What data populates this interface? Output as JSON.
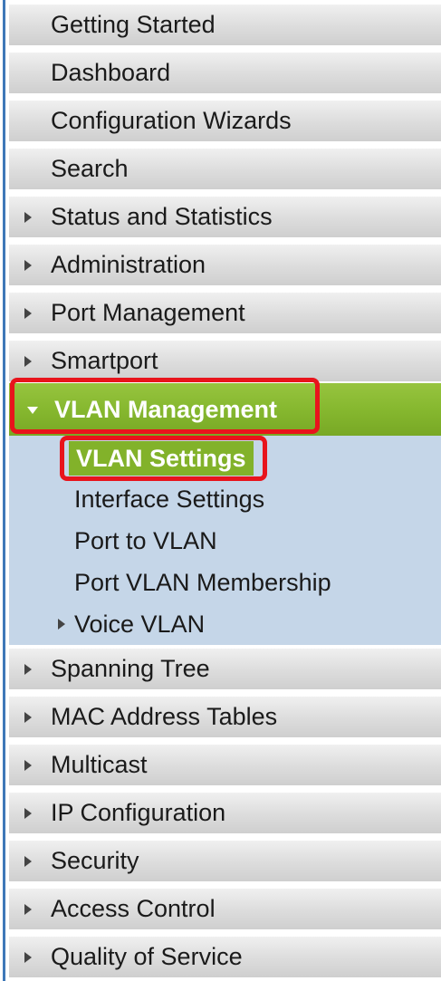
{
  "nav": {
    "items_top": [
      {
        "label": "Getting Started",
        "has_arrow": false
      },
      {
        "label": "Dashboard",
        "has_arrow": false
      },
      {
        "label": "Configuration Wizards",
        "has_arrow": false
      },
      {
        "label": "Search",
        "has_arrow": false
      },
      {
        "label": "Status and Statistics",
        "has_arrow": true
      },
      {
        "label": "Administration",
        "has_arrow": true
      },
      {
        "label": "Port Management",
        "has_arrow": true
      },
      {
        "label": "Smartport",
        "has_arrow": true
      }
    ],
    "active_section": {
      "label": "VLAN Management",
      "expanded": true,
      "highlight_color": "#e8141c",
      "active_color": "#86b82f"
    },
    "submenu": [
      {
        "label": "VLAN Settings",
        "selected": true
      },
      {
        "label": "Interface Settings",
        "selected": false
      },
      {
        "label": "Port to VLAN",
        "selected": false
      },
      {
        "label": "Port VLAN Membership",
        "selected": false
      },
      {
        "label": "Voice VLAN",
        "selected": false,
        "has_arrow": true
      }
    ],
    "items_bottom": [
      {
        "label": "Spanning Tree",
        "has_arrow": true
      },
      {
        "label": "MAC Address Tables",
        "has_arrow": true
      },
      {
        "label": "Multicast",
        "has_arrow": true
      },
      {
        "label": "IP Configuration",
        "has_arrow": true
      },
      {
        "label": "Security",
        "has_arrow": true
      },
      {
        "label": "Access Control",
        "has_arrow": true
      },
      {
        "label": "Quality of Service",
        "has_arrow": true
      }
    ]
  }
}
